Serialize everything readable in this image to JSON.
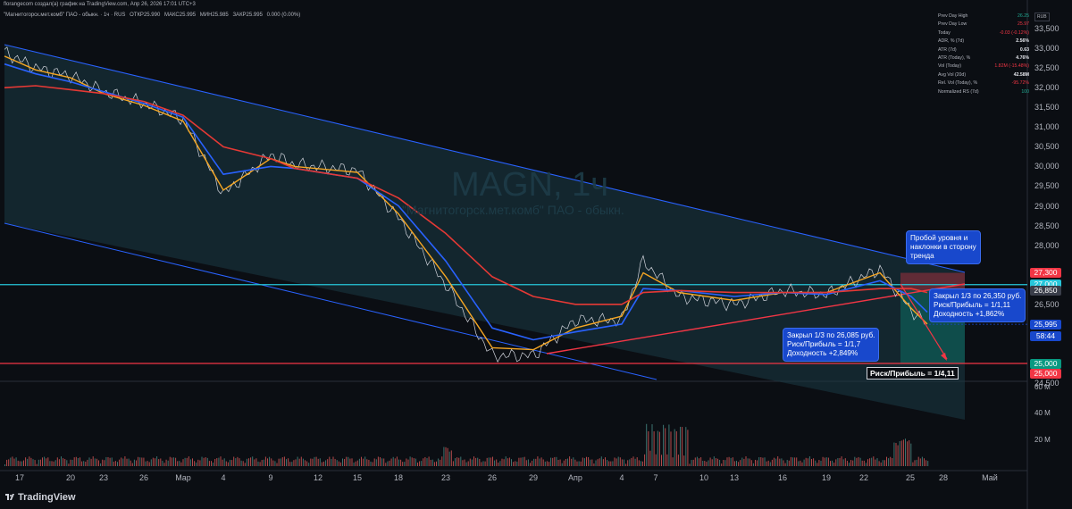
{
  "header": {
    "title": "florangecom создал(а) график на TradingView.com, Апр 26, 2026 17:01 UTC+3",
    "symbol_line": [
      "\"Магнитогорск.мет.комб\" ПАО - обыкн. · 1ч · RUS",
      "ОТКР25.990",
      "МАКС25.995",
      "МИН25.985",
      "ЗАКР25.995",
      "0.000 (0.00%)"
    ]
  },
  "watermark": {
    "symbol": "MAGN, 1ч",
    "name": "\"Магнитогорск.мет.комб\" ПАО - обыкн."
  },
  "currency_button": "RUB",
  "stats_table": [
    {
      "label": "Prev Day High",
      "value": "26.25",
      "style": "pos"
    },
    {
      "label": "Prev Day Low",
      "value": "25.97",
      "style": "neg"
    },
    {
      "label": "Today",
      "value": "-0.03 (-0.12%)",
      "style": "neg"
    },
    {
      "label": "ADR, % (7d)",
      "value": "2.56%",
      "style": "v"
    },
    {
      "label": "ATR (7d)",
      "value": "0.63",
      "style": "v"
    },
    {
      "label": "ATR (Today), %",
      "value": "4.76%",
      "style": "v"
    },
    {
      "label": "Vol (Today)",
      "value": "1.82M (-15.48%)",
      "style": "neg"
    },
    {
      "label": "Avg Vol (20d)",
      "value": "42.58M",
      "style": "v"
    },
    {
      "label": "Rel. Vol (Today), %",
      "value": "-95.72%",
      "style": "neg"
    },
    {
      "label": "Normalized RS (7d)",
      "value": "100",
      "style": "pos"
    }
  ],
  "price_axis": {
    "ticks": [
      "33,500",
      "33,000",
      "32,500",
      "32,000",
      "31,500",
      "31,000",
      "30,500",
      "30,000",
      "29,500",
      "29,000",
      "28,500",
      "28,000",
      "26,500",
      "26,000",
      "24,500"
    ],
    "tags": [
      {
        "text": "27,300",
        "bg": "#f23645",
        "price": 27300
      },
      {
        "text": "27,000",
        "bg": "#26c6da",
        "price": 27000
      },
      {
        "text": "26,850",
        "bg": "#3a3e4a",
        "price": 26850
      },
      {
        "text": "25,995",
        "bg": "#1848cc",
        "price": 25995
      },
      {
        "text": "58:44",
        "bg": "#1848cc",
        "price": 25700
      },
      {
        "text": "25,000",
        "bg": "#089981",
        "price": 25000
      },
      {
        "text": "25,000",
        "bg": "#f23645",
        "price": 24745
      }
    ]
  },
  "volume_axis": [
    "60 M",
    "40 M",
    "20 M"
  ],
  "time_axis": [
    "17",
    "20",
    "23",
    "26",
    "Мар",
    "4",
    "9",
    "12",
    "15",
    "18",
    "23",
    "26",
    "29",
    "Апр",
    "4",
    "7",
    "10",
    "13",
    "16",
    "19",
    "22",
    "25",
    "28",
    "Май"
  ],
  "annotations": {
    "breakout": "Пробой уровня и\nнаклонки в сторону\nтренда",
    "close2": "Закрыл 1/3 по 26,350 руб.\nРиск/Прибыль = 1/1,11\nДоходность +1,862%",
    "close1": "Закрыл 1/3 по 26,085 руб.\nРиск/Прибыль = 1/1,7\nДоходность +2,849%",
    "risk_reward": "Риск/Прибыль = 1/4,11"
  },
  "brand": "TradingView",
  "chart_data": {
    "type": "line",
    "title": "MAGN, 1ч",
    "ylim": [
      24500,
      33800
    ],
    "colors": {
      "price": "#d1d4dc",
      "ma_fast": "#f5a623",
      "ma_mid": "#2962ff",
      "ma_slow": "#e53935",
      "channel": "#2962ff",
      "level": "#26c6da",
      "support": "#f23645"
    },
    "price_path_x": [
      "17",
      "20",
      "23",
      "26",
      "Мар",
      "4",
      "9",
      "12",
      "15",
      "18",
      "23",
      "26",
      "29",
      "Апр",
      "4",
      "7",
      "10",
      "13",
      "16",
      "19",
      "22",
      "25"
    ],
    "series": [
      {
        "name": "price",
        "values": [
          32900,
          32500,
          32300,
          31900,
          31600,
          31200,
          29300,
          30300,
          30050,
          29900,
          28700,
          27000,
          25200,
          25200,
          26100,
          26100,
          27600,
          26700,
          26500,
          26850,
          26750,
          27400,
          26350,
          25995
        ]
      },
      {
        "name": "ma_fast",
        "values": [
          32800,
          32450,
          32250,
          31850,
          31550,
          31150,
          29400,
          30200,
          30000,
          29850,
          28800,
          27200,
          25400,
          25350,
          25900,
          26200,
          27300,
          26800,
          26600,
          26800,
          26800,
          27300,
          26400,
          26000
        ]
      },
      {
        "name": "ma_mid",
        "values": [
          32600,
          32350,
          32150,
          31900,
          31600,
          31250,
          29800,
          30000,
          29950,
          29700,
          29000,
          27600,
          25900,
          25600,
          25800,
          26000,
          26900,
          26850,
          26700,
          26800,
          26750,
          27100,
          26700,
          26300
        ]
      },
      {
        "name": "ma_slow",
        "values": [
          32000,
          32050,
          31950,
          31850,
          31650,
          31300,
          30500,
          30200,
          29950,
          29700,
          29200,
          28300,
          27200,
          26700,
          26500,
          26500,
          26800,
          26850,
          26800,
          26800,
          26800,
          26900,
          26900,
          26800
        ]
      }
    ],
    "levels": {
      "resistance": 27000,
      "stop": 27300,
      "target": 25000,
      "entry": 26850
    }
  }
}
